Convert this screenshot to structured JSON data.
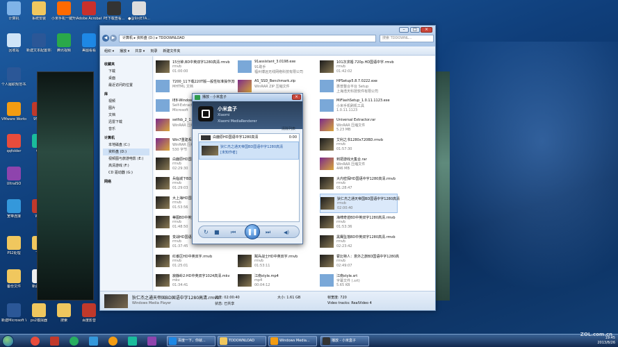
{
  "desktop": {
    "icons": [
      {
        "label": "计算机",
        "icon": "computer-icon",
        "color": "#7fb3e8"
      },
      {
        "label": "系统安装",
        "icon": "folder-icon",
        "color": "#f0c75e"
      },
      {
        "label": "小米手机一键升级",
        "icon": "xiaomi-icon",
        "color": "#ff6a00"
      },
      {
        "label": "Adobe Acrobat...",
        "icon": "acrobat-icon",
        "color": "#c9302c"
      },
      {
        "label": "PE下载查看...",
        "icon": "pe-icon",
        "color": "#333"
      },
      {
        "label": "●@9月E7A...",
        "icon": "document-icon",
        "color": "#ddd"
      },
      {
        "label": "回收站",
        "icon": "recycle-bin-icon",
        "color": "#cfe4f7"
      },
      {
        "label": "新建文本配置单打印.doc",
        "icon": "word-doc-icon",
        "color": "#2b5797"
      },
      {
        "label": "腾讯视频",
        "icon": "video-icon",
        "color": "#2aa84a"
      },
      {
        "label": "美图看看",
        "icon": "image-viewer-icon",
        "color": "#1e88e5"
      },
      {
        "label": "个人履职规范书.doc",
        "icon": "word-doc-icon",
        "color": "#2b5797"
      },
      {
        "label": "VMware Workstation",
        "icon": "vmware-icon",
        "color": "#f39c12"
      },
      {
        "label": "95599",
        "icon": "app-icon",
        "color": "#c0392b"
      },
      {
        "label": "qqfolder",
        "icon": "qq-icon",
        "color": "#e74c3c"
      },
      {
        "label": "QQ",
        "icon": "qq-icon",
        "color": "#1abc9c"
      },
      {
        "label": "UltraISO",
        "icon": "disc-icon",
        "color": "#8e44ad"
      },
      {
        "label": "宽带连接",
        "icon": "network-icon",
        "color": "#3498db"
      },
      {
        "label": "WPS",
        "icon": "wps-icon",
        "color": "#c0392b"
      },
      {
        "label": "PS2处理",
        "icon": "folder-icon",
        "color": "#f0c75e"
      },
      {
        "label": "下载",
        "icon": "folder-icon",
        "color": "#f0c75e"
      },
      {
        "label": "备份文件",
        "icon": "folder-icon",
        "color": "#f0c75e"
      },
      {
        "label": "新建文本",
        "icon": "document-icon",
        "color": "#eee"
      },
      {
        "label": "新建Microsoft Word",
        "icon": "word-doc-icon",
        "color": "#2b5797"
      },
      {
        "label": "ps2模拟器",
        "icon": "folder-icon",
        "color": "#f0c75e"
      },
      {
        "label": "搜索",
        "icon": "folder-icon",
        "color": "#f0c75e"
      },
      {
        "label": "百度影音",
        "icon": "media-icon",
        "color": "#c0392b"
      }
    ]
  },
  "explorer": {
    "address": [
      "计算机",
      "资料盘 (D:)",
      "TDDOWNLOAD"
    ],
    "search_placeholder": "搜索 TDDOWNL...",
    "toolbar": [
      "组织 ▾",
      "播放 ▾",
      "共享 ▾",
      "刻录",
      "新建文件夹"
    ],
    "nav": [
      {
        "label": "收藏夹",
        "header": true
      },
      {
        "label": "下载"
      },
      {
        "label": "桌面"
      },
      {
        "label": "最近访问的位置"
      },
      {
        "label": "库",
        "header": true
      },
      {
        "label": "视频"
      },
      {
        "label": "图片"
      },
      {
        "label": "文档"
      },
      {
        "label": "迅雷下载"
      },
      {
        "label": "音乐"
      },
      {
        "label": "计算机",
        "header": true
      },
      {
        "label": "本地磁盘 (C:)"
      },
      {
        "label": "资料盘 (D:)",
        "selected": true
      },
      {
        "label": "视频图与旅游电影 (E:)"
      },
      {
        "label": "高清游戏 (F:)"
      },
      {
        "label": "CD 驱动器 (G:)"
      },
      {
        "label": "网络",
        "header": true
      }
    ],
    "files": [
      {
        "name": "15分钟,BD中英双字1280高清.rmvb",
        "type": "rmvb",
        "meta": "01:00:00",
        "col": 0
      },
      {
        "name": "7200_11下载220T版—般性标准操作流程数据恢复-硬盘数据恢复教程.mht",
        "type": "MHTML 文档",
        "meta": "",
        "col": 0
      },
      {
        "name": "IE8-WindowsXP...",
        "type": "Self-Extracting",
        "meta": "Microsoft",
        "col": 0
      },
      {
        "name": "setfsb_2_1...",
        "type": "WinRAR 压缩文件",
        "meta": "",
        "col": 0
      },
      {
        "name": "Win7重建系统...",
        "type": "WinRAR 压缩文件",
        "meta": "530 字节",
        "col": 0
      },
      {
        "name": "白鹿原HD国...",
        "type": "rmvb",
        "meta": "02:29:30",
        "col": 0
      },
      {
        "name": "兵临城下BD...",
        "type": "rmvb",
        "meta": "01:29:03",
        "col": 0
      },
      {
        "name": "大上海HD国...",
        "type": "rmvb",
        "meta": "01:53:56",
        "col": 0
      },
      {
        "name": "蒂图BD中英双字.rmvb",
        "type": "rmvb",
        "meta": "01:48:50",
        "col": 0
      },
      {
        "name": "变战HD国语中字.rmvb",
        "type": "rmvb",
        "meta": "01:37:45",
        "col": 0
      },
      {
        "name": "红番区HD中英双字.rmvb",
        "type": "rmvb",
        "meta": "01:25:01",
        "col": 0
      },
      {
        "name": "寂静岭2:HD中英双字1024高清.mkv",
        "type": "mkv",
        "meta": "01:34:41",
        "col": 0
      },
      {
        "name": "91assistant_3.0198.exe",
        "type": "91助手",
        "meta": "福州博远无线网络科技有限公司",
        "col": 1
      },
      {
        "name": "AS_SSD_Benchmark.zip",
        "type": "WinRAR ZIP 压缩文件",
        "meta": "",
        "col": 1
      },
      {
        "name": "",
        "type": "",
        "meta": "",
        "col": 1
      },
      {
        "name": "",
        "type": "",
        "meta": "",
        "col": 1
      },
      {
        "name": "",
        "type": "",
        "meta": "",
        "col": 1
      },
      {
        "name": "",
        "type": "",
        "meta": "",
        "col": 1
      },
      {
        "name": "",
        "type": "",
        "meta": "",
        "col": 1
      },
      {
        "name": "",
        "type": "",
        "meta": "",
        "col": 1
      },
      {
        "name": "",
        "type": "",
        "meta": "",
        "col": 1
      },
      {
        "name": "",
        "type": "",
        "meta": "",
        "col": 1
      },
      {
        "name": "贼兵战士HD中英双字.rmvb",
        "type": "rmvb",
        "meta": "01:53:11",
        "col": 1
      },
      {
        "name": "江南style.mp4",
        "type": "mp4",
        "meta": "00:04:12",
        "col": 1
      },
      {
        "name": "101次求婚.720p.HD国语中字.rmvb",
        "type": "rmvb",
        "meta": "01:42:02",
        "col": 2
      },
      {
        "name": "HPSetup5.8.7.0222.exe",
        "type": "惠普整合平台 Setup",
        "meta": "上海浩天科技软件有限公司",
        "col": 2
      },
      {
        "name": "MiFlashSetup_1.0.11.1123.exe",
        "type": "小米手机刷机工具",
        "meta": "1.0.11.1123",
        "col": 2
      },
      {
        "name": "Universal Extractor.rar",
        "type": "WinRAR 压缩文件",
        "meta": "5.23 MB",
        "col": 2
      },
      {
        "name": "艾利之书1280x720BD.rmvb",
        "type": "rmvb",
        "meta": "01:57:30",
        "col": 2
      },
      {
        "name": "到把游戏大集合.rar",
        "type": "WinRAR 压缩文件",
        "meta": "446 MB",
        "col": 2
      },
      {
        "name": "大内密探HD国语中字1280高清.rmvb",
        "type": "rmvb",
        "meta": "01:28:47",
        "col": 2
      },
      {
        "name": "狄仁杰之通天帝国BD国语中字1280高清.rmvb",
        "type": "rmvb",
        "meta": "02:00:40",
        "col": 2,
        "selected": true
      },
      {
        "name": "海啸奇迹BD中英双字1280高清.rmvb",
        "type": "rmvb",
        "meta": "01:53:36",
        "col": 2
      },
      {
        "name": "黑鹰坠落BD中英双字1280高清.rmvb",
        "type": "rmvb",
        "meta": "02:23:42",
        "col": 2
      },
      {
        "name": "霍比特人：意外之旅BD国语中字1280高清无水印.rmvb",
        "type": "rmvb",
        "meta": "02:49:07",
        "col": 2
      },
      {
        "name": "江南style.srt",
        "type": "字幕文件 (.srt)",
        "meta": "5.65 KB",
        "col": 2
      }
    ],
    "details": {
      "name": "狄仁杰之通天帝国BD国语中字1280高清.rmvb",
      "app": "Windows Media Player",
      "status_label": "状态:",
      "status": "已共享",
      "size_label": "大小:",
      "size": "1.61 GB",
      "length_label": "长度:",
      "length": "02:00:40",
      "width_label": "帧宽度:",
      "width": "720",
      "codec_label": "Video tracks:",
      "codec": "RealVideo 4"
    }
  },
  "dialog": {
    "title": "播放 - 小米盒子",
    "device_name": "小米盒子",
    "device_maker": "Xiaomi",
    "device_model": "Xiaomi MediaRenderer",
    "clear_list": "清除列表",
    "playlist": [
      {
        "title": "白鹿原HD国语中字1280高清",
        "time": "0:00"
      },
      {
        "title": "狄仁杰之通天帝国BD国语中字1280高清",
        "status": "[未知作者]",
        "selected": true
      }
    ]
  },
  "taskbar": {
    "tasks": [
      {
        "label": "百度一下，你就...",
        "icon_color": "#1e88e5"
      },
      {
        "label": "TDDOWNLOAD",
        "icon_color": "#f0c75e"
      },
      {
        "label": "Windows Media...",
        "icon_color": "#f39c12"
      },
      {
        "label": "播放 - 小米盒子",
        "icon_color": "#333"
      }
    ],
    "time": "19:45",
    "date": "2013/8/26"
  },
  "watermark": "ZOL.com.cn"
}
